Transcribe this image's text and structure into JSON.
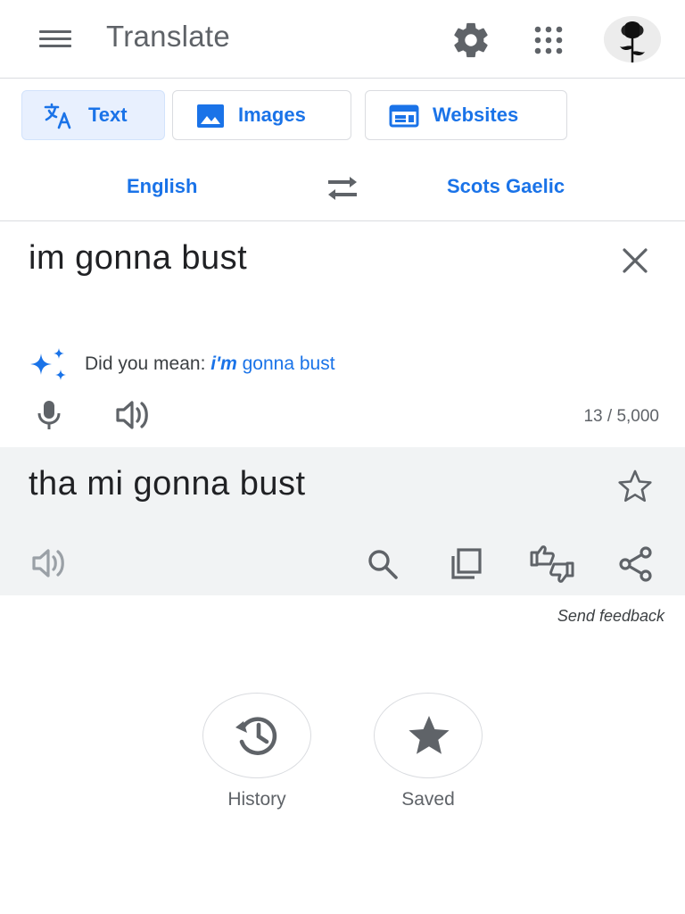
{
  "header": {
    "title": "Translate",
    "icons": [
      "menu-icon",
      "settings-icon",
      "apps-grid-icon",
      "avatar"
    ]
  },
  "modes": [
    {
      "label": "Text",
      "icon": "translate-icon",
      "active": true
    },
    {
      "label": "Images",
      "icon": "image-icon",
      "active": false
    },
    {
      "label": "Websites",
      "icon": "web-icon",
      "active": false
    }
  ],
  "languages": {
    "source": "English",
    "target": "Scots Gaelic",
    "swap_icon": "swap-icon"
  },
  "source": {
    "text": "im gonna bust",
    "did_you_mean_prefix": "Did you mean:",
    "did_you_mean_corrected": "i'm",
    "did_you_mean_rest": "gonna bust",
    "char_count": "13 / 5,000"
  },
  "target": {
    "text": "tha mi gonna bust",
    "icons": [
      "star-icon",
      "speaker-icon",
      "search-icon",
      "copy-icon",
      "rate-icon",
      "share-icon"
    ]
  },
  "feedback_label": "Send feedback",
  "bottom": {
    "history_label": "History",
    "saved_label": "Saved"
  },
  "colors": {
    "accent": "#1a73e8",
    "icon_gray": "#5f6368",
    "panel_bg": "#f1f3f4",
    "chip_active_bg": "#e8f0fe"
  }
}
